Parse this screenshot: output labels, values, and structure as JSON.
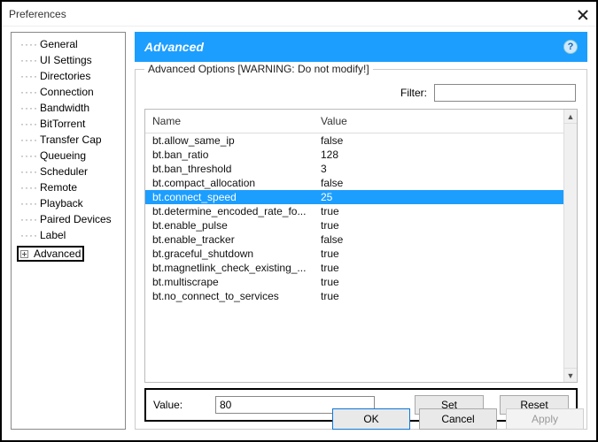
{
  "window": {
    "title": "Preferences"
  },
  "sidebar": {
    "items": [
      {
        "label": "General"
      },
      {
        "label": "UI Settings"
      },
      {
        "label": "Directories"
      },
      {
        "label": "Connection"
      },
      {
        "label": "Bandwidth"
      },
      {
        "label": "BitTorrent"
      },
      {
        "label": "Transfer Cap"
      },
      {
        "label": "Queueing"
      },
      {
        "label": "Scheduler"
      },
      {
        "label": "Remote"
      },
      {
        "label": "Playback"
      },
      {
        "label": "Paired Devices"
      },
      {
        "label": "Label"
      }
    ],
    "advanced": {
      "label": "Advanced"
    }
  },
  "header": {
    "title": "Advanced"
  },
  "group": {
    "legend": "Advanced Options [WARNING: Do not modify!]"
  },
  "filter": {
    "label": "Filter:",
    "value": ""
  },
  "table": {
    "headers": {
      "name": "Name",
      "value": "Value"
    },
    "rows": [
      {
        "name": "bt.allow_same_ip",
        "value": "false",
        "selected": false
      },
      {
        "name": "bt.ban_ratio",
        "value": "128",
        "selected": false
      },
      {
        "name": "bt.ban_threshold",
        "value": "3",
        "selected": false
      },
      {
        "name": "bt.compact_allocation",
        "value": "false",
        "selected": false
      },
      {
        "name": "bt.connect_speed",
        "value": "25",
        "selected": true
      },
      {
        "name": "bt.determine_encoded_rate_fo...",
        "value": "true",
        "selected": false
      },
      {
        "name": "bt.enable_pulse",
        "value": "true",
        "selected": false
      },
      {
        "name": "bt.enable_tracker",
        "value": "false",
        "selected": false
      },
      {
        "name": "bt.graceful_shutdown",
        "value": "true",
        "selected": false
      },
      {
        "name": "bt.magnetlink_check_existing_...",
        "value": "true",
        "selected": false
      },
      {
        "name": "bt.multiscrape",
        "value": "true",
        "selected": false
      },
      {
        "name": "bt.no_connect_to_services",
        "value": "true",
        "selected": false
      }
    ]
  },
  "value_edit": {
    "label": "Value:",
    "value": "80",
    "set": "Set",
    "reset": "Reset"
  },
  "buttons": {
    "ok": "OK",
    "cancel": "Cancel",
    "apply": "Apply"
  }
}
